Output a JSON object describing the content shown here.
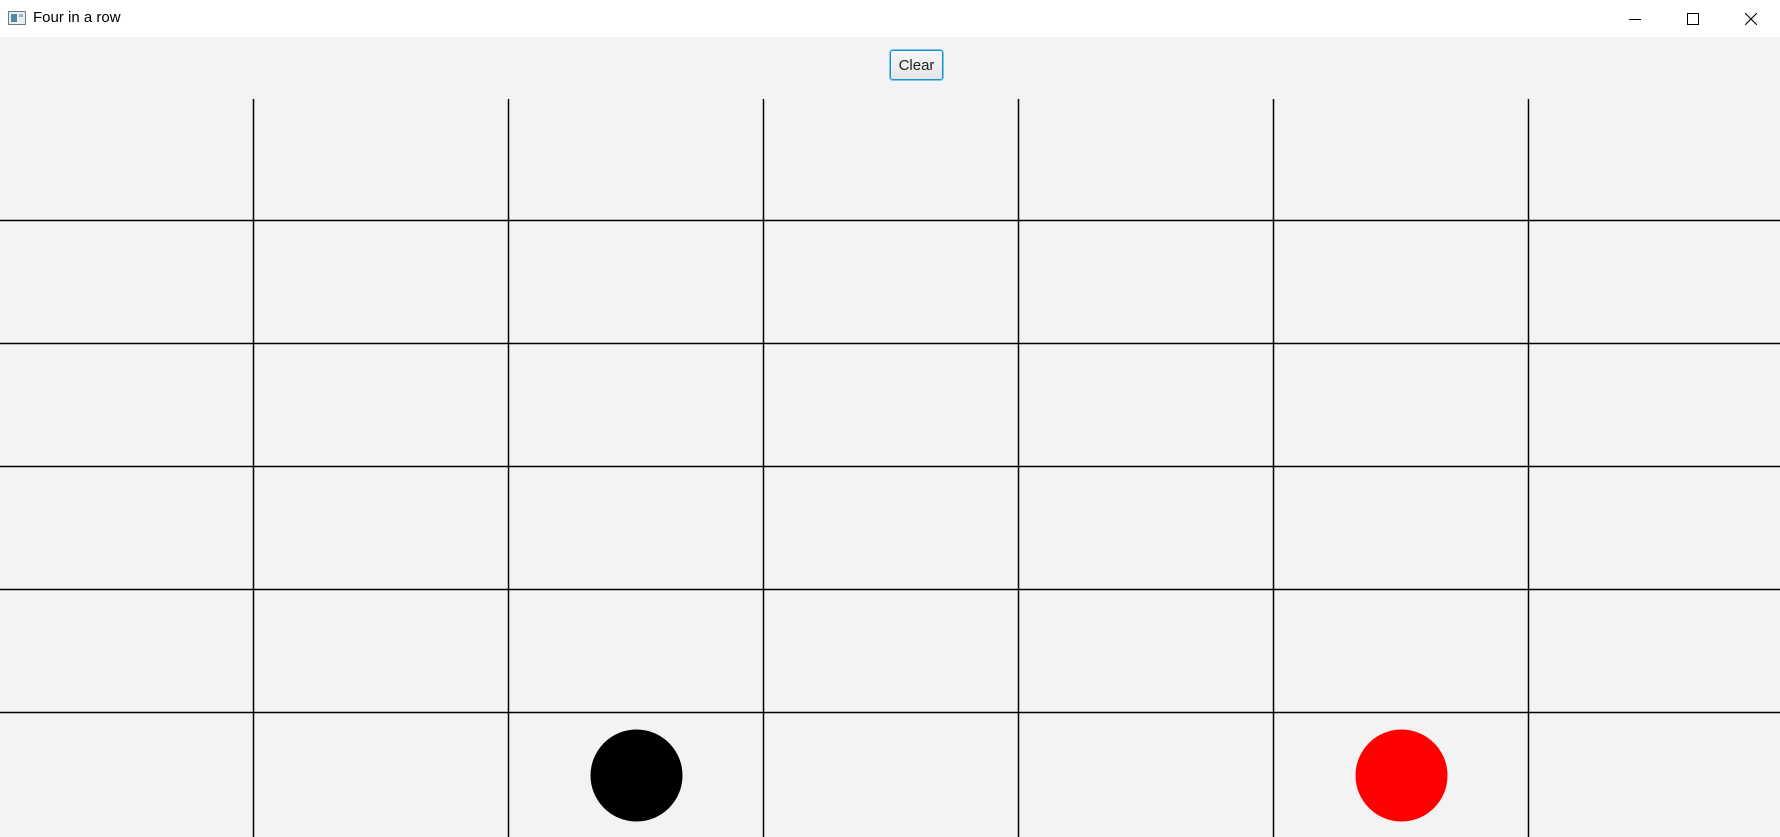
{
  "window": {
    "title": "Four in a row",
    "app_icon": "app-window-icon",
    "controls": [
      "minimize-icon",
      "maximize-icon",
      "close-icon"
    ]
  },
  "toolbar": {
    "clear_label": "Clear",
    "accent_color": "#1e8fd3"
  },
  "board": {
    "columns": 7,
    "rows": 6,
    "background_color": "#f3f3f3",
    "line_color": "#000000",
    "pieces": [
      {
        "row": 6,
        "col": 3,
        "color": "#000000",
        "player": "black"
      },
      {
        "row": 6,
        "col": 6,
        "color": "#ff0000",
        "player": "red"
      }
    ]
  }
}
